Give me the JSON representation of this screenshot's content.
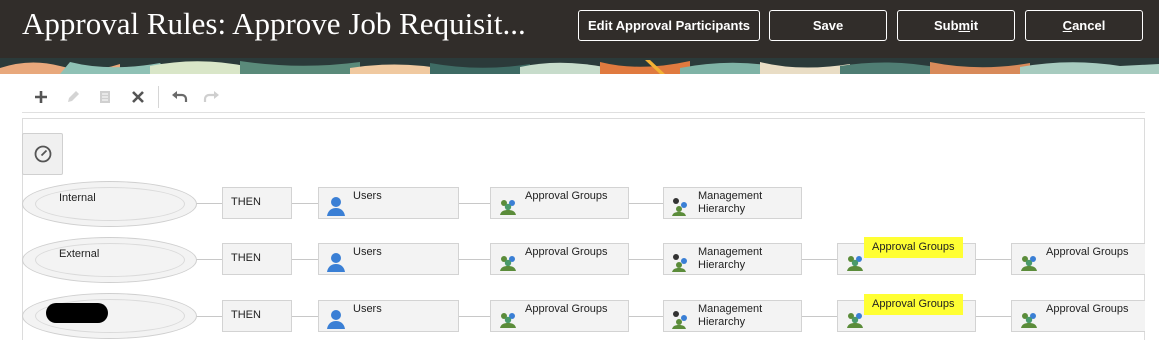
{
  "header": {
    "title": "Approval Rules: Approve Job Requisit...",
    "buttons": {
      "edit_participants": "Edit Approval Participants",
      "save": "Save",
      "submit_pre": "Sub",
      "submit_key": "m",
      "submit_post": "it",
      "cancel_key": "C",
      "cancel_post": "ancel"
    }
  },
  "toolbar": {
    "icons": [
      "add-icon",
      "edit-icon",
      "copy-icon",
      "delete-icon",
      "undo-icon",
      "redo-icon"
    ]
  },
  "rules": [
    {
      "condition": "Internal",
      "then": "THEN",
      "steps": [
        "Users",
        "Approval Groups",
        "Management Hierarchy"
      ]
    },
    {
      "condition": "External",
      "then": "THEN",
      "steps": [
        "Users",
        "Approval Groups",
        "Management Hierarchy",
        "Approval Groups",
        "Approval Groups"
      ]
    },
    {
      "condition": "",
      "then": "THEN",
      "steps": [
        "Users",
        "Approval Groups",
        "Management Hierarchy",
        "Approval Groups",
        "Approval Groups"
      ]
    }
  ],
  "labels": {
    "management_1": "Management",
    "management_2": "Hierarchy"
  },
  "colors": {
    "header_bg": "#312d2a",
    "highlight": "#ffff33",
    "users_icon": "#3a7fd5",
    "groups_icon": "#5b8c3a"
  }
}
